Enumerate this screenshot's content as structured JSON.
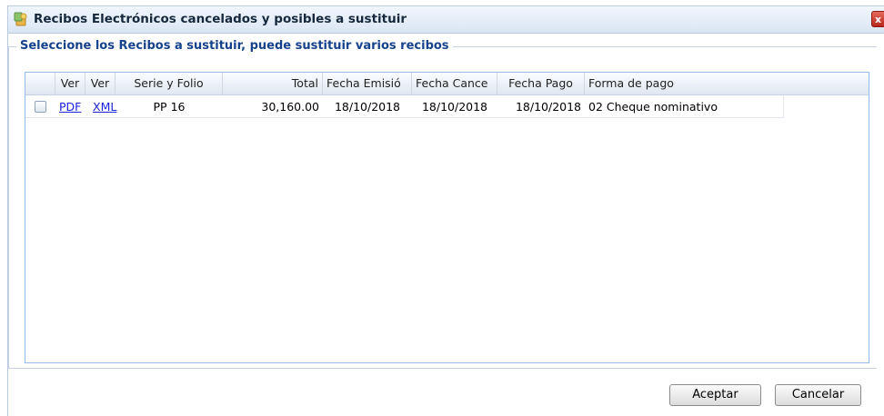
{
  "window": {
    "title": "Recibos Electrónicos cancelados y posibles a sustituir",
    "close_label": "x"
  },
  "panel": {
    "legend": "Seleccione los Recibos a sustituir, puede sustituir varios recibos"
  },
  "grid": {
    "headers": {
      "ver1": "Ver",
      "ver2": "Ver",
      "serie": "Serie y Folio",
      "total": "Total",
      "fecha_emision": "Fecha Emisió",
      "fecha_cancelacion": "Fecha Cance",
      "fecha_pago": "Fecha Pago",
      "forma_pago": "Forma de pago"
    },
    "rows": [
      {
        "checked": false,
        "pdf": "PDF",
        "xml": "XML",
        "serie": "PP 16",
        "total": "30,160.00",
        "fecha_emision": "18/10/2018",
        "fecha_cancelacion": "18/10/2018",
        "fecha_pago": "18/10/2018",
        "forma_pago": "02 Cheque nominativo"
      }
    ]
  },
  "buttons": {
    "accept": "Aceptar",
    "cancel": "Cancelar"
  }
}
